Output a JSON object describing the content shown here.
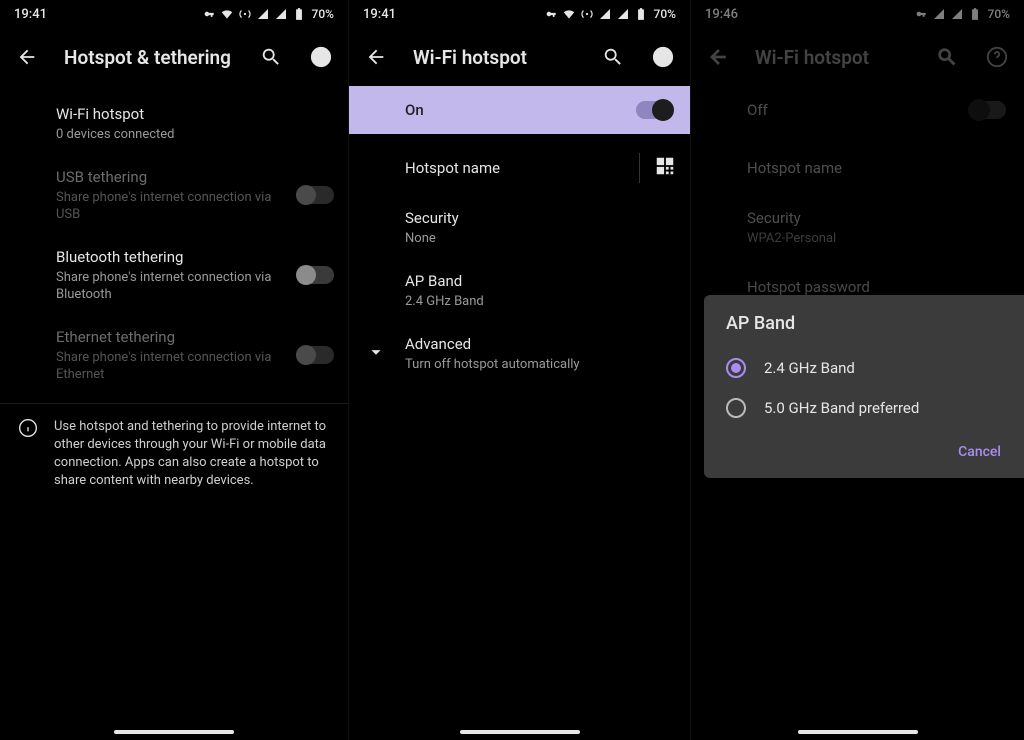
{
  "statusbar_icons": [
    "vpn-key-icon",
    "wifi-icon",
    "hotspot-icon",
    "signal-icon",
    "signal-icon",
    "battery-icon"
  ],
  "panes": {
    "hotspot_tethering": {
      "time": "19:41",
      "battery": "70%",
      "title": "Hotspot & tethering",
      "items": [
        {
          "title": "Wi-Fi hotspot",
          "subtitle": "0 devices connected",
          "enabled": true,
          "toggle": null
        },
        {
          "title": "USB tethering",
          "subtitle": "Share phone's internet connection via USB",
          "enabled": false,
          "toggle": false
        },
        {
          "title": "Bluetooth tethering",
          "subtitle": "Share phone's internet connection via Bluetooth",
          "enabled": true,
          "toggle": false
        },
        {
          "title": "Ethernet tethering",
          "subtitle": "Share phone's internet connection via Ethernet",
          "enabled": false,
          "toggle": false
        }
      ],
      "info": "Use hotspot and tethering to provide internet to other devices through your Wi-Fi or mobile data connection. Apps can also create a hotspot to share content with nearby devices."
    },
    "wifi_hotspot_on": {
      "time": "19:41",
      "battery": "70%",
      "title": "Wi-Fi hotspot",
      "hero_label": "On",
      "hero_state": true,
      "items": [
        {
          "title": "Hotspot name",
          "subtitle": "",
          "qr": true
        },
        {
          "title": "Security",
          "subtitle": "None"
        },
        {
          "title": "AP Band",
          "subtitle": "2.4 GHz Band"
        },
        {
          "title": "Advanced",
          "subtitle": "Turn off hotspot automatically",
          "expand": true
        }
      ]
    },
    "wifi_hotspot_dialog": {
      "time": "19:46",
      "battery": "70%",
      "title": "Wi-Fi hotspot",
      "hero_label": "Off",
      "hero_state": false,
      "items": [
        {
          "title": "Hotspot name",
          "subtitle": ""
        },
        {
          "title": "Security",
          "subtitle": "WPA2-Personal"
        },
        {
          "title": "Hotspot password",
          "subtitle": ""
        }
      ],
      "dialog": {
        "title": "AP Band",
        "options": [
          {
            "label": "2.4 GHz Band",
            "selected": true
          },
          {
            "label": "5.0 GHz Band preferred",
            "selected": false
          }
        ],
        "cancel": "Cancel"
      }
    }
  }
}
